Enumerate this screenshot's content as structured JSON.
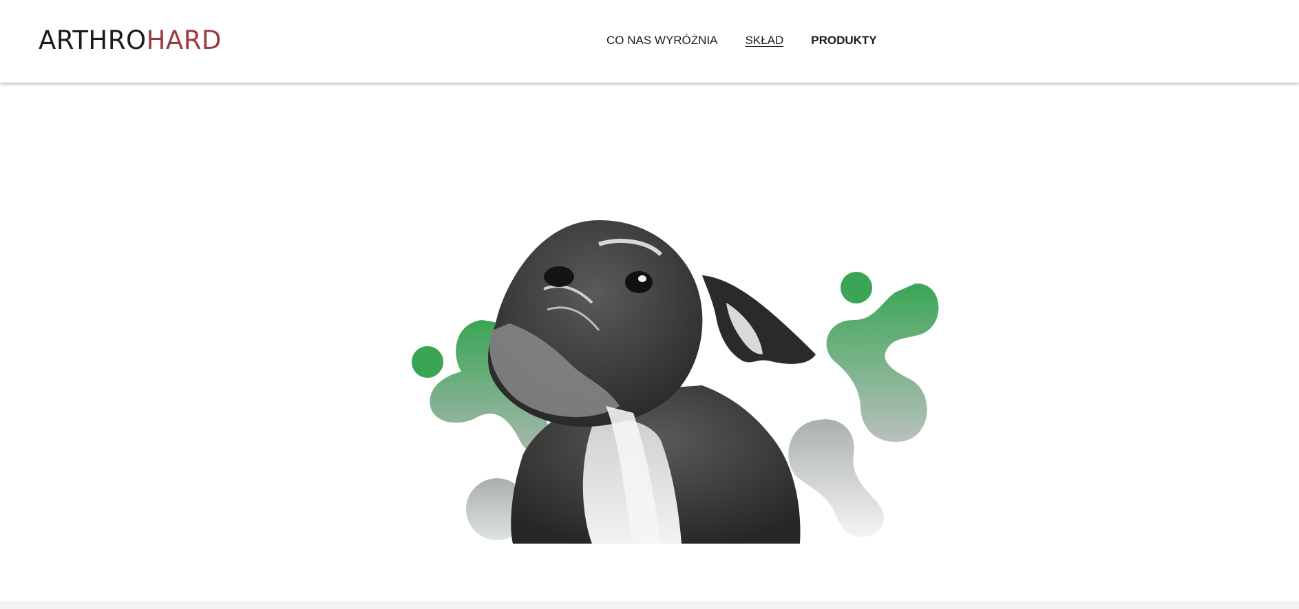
{
  "brand": {
    "logo_part_1": "ARTHRO",
    "logo_part_2": "HARD",
    "logo_color_primary": "#1a1a1a",
    "logo_color_accent": "#9b3b3b"
  },
  "nav": {
    "items": [
      {
        "label": "CO NAS WYRÓŻNIA",
        "state": "normal"
      },
      {
        "label": "SKŁAD",
        "state": "active-underlined"
      },
      {
        "label": "PRODUKTY",
        "state": "bold"
      }
    ]
  },
  "hero": {
    "image": "drawn-french-bulldog-illustration",
    "decor": "green-gradient-molecule-blobs",
    "colors": {
      "blob_green": "#3aa655",
      "blob_grey": "#bfc4c2",
      "dog_dark": "#2e2e2e",
      "dog_light": "#e2e2e2"
    }
  }
}
